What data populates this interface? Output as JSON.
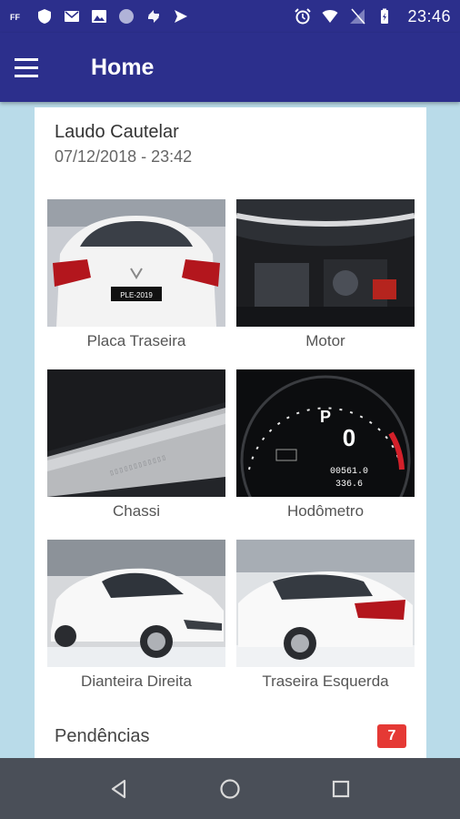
{
  "status_bar": {
    "time": "23:46",
    "left_icons": [
      "ff-icon",
      "shield-icon",
      "mail-icon",
      "image-icon",
      "circle-icon",
      "sync-icon",
      "send-icon"
    ],
    "right_icons": [
      "alarm-icon",
      "wifi-icon",
      "signal-icon",
      "battery-icon"
    ]
  },
  "app_bar": {
    "title": "Home"
  },
  "card": {
    "title": "Laudo Cautelar",
    "date": "07/12/2018 - 23:42"
  },
  "photos": [
    {
      "label": "Placa Traseira"
    },
    {
      "label": "Motor"
    },
    {
      "label": "Chassi"
    },
    {
      "label": "Hodômetro"
    },
    {
      "label": "Dianteira Direita"
    },
    {
      "label": "Traseira Esquerda"
    }
  ],
  "plate_text": "PLE-2019",
  "odometer": {
    "gear": "P",
    "speed": "0",
    "trip": "00561.0",
    "range": "336.6"
  },
  "pendencias": {
    "label": "Pendências",
    "count": "7"
  },
  "colors": {
    "primary": "#2c2f8c",
    "background": "#b9dbe9",
    "badge": "#e53935",
    "nav_bar": "#4a4f58"
  }
}
